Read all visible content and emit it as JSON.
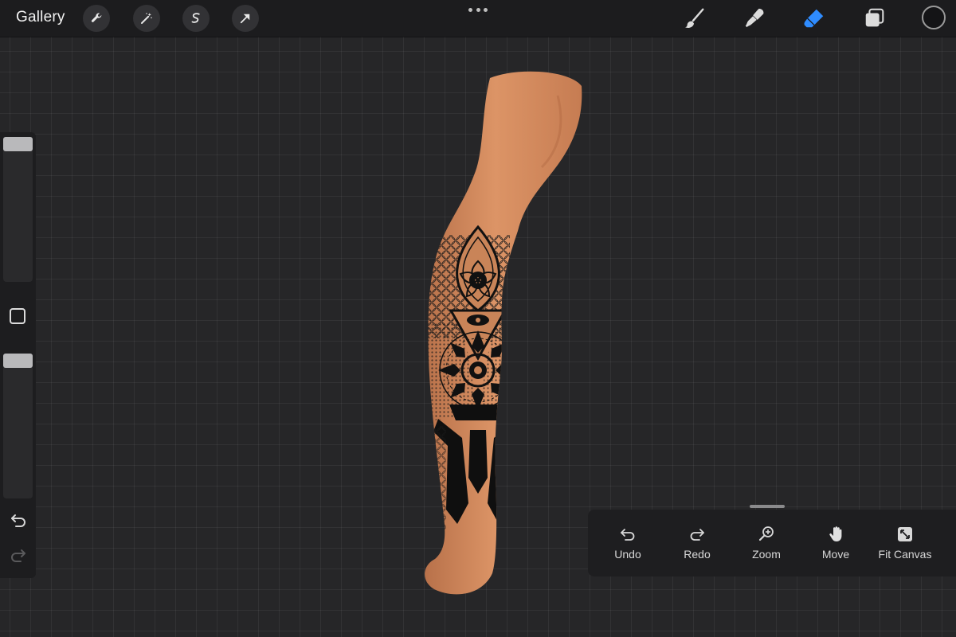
{
  "topbar": {
    "gallery_label": "Gallery",
    "left_tools": [
      "wrench-icon",
      "magic-wand-icon",
      "selection-s-icon",
      "transform-arrow-icon"
    ],
    "right_tools": [
      "brush-icon",
      "smudge-icon",
      "eraser-icon",
      "layers-icon"
    ],
    "active_tool": "eraser",
    "active_color": "#141416",
    "accent_color": "#2f8cff"
  },
  "sidebar": {
    "brush_size": 0.0,
    "opacity": 0.0,
    "undo_icon": "undo-arrow-icon",
    "redo_icon": "redo-arrow-icon"
  },
  "canvas": {
    "background": "#262628",
    "grid": true,
    "subject": "leg-with-geometric-mandala-tattoo",
    "skin_color": "#d58a5c",
    "ink_color": "#141414"
  },
  "gesture_panel": {
    "items": [
      {
        "label": "Undo",
        "icon": "undo-icon"
      },
      {
        "label": "Redo",
        "icon": "redo-icon"
      },
      {
        "label": "Zoom",
        "icon": "zoom-icon"
      },
      {
        "label": "Move",
        "icon": "hand-icon"
      },
      {
        "label": "Fit Canvas",
        "icon": "fit-canvas-icon"
      }
    ]
  }
}
